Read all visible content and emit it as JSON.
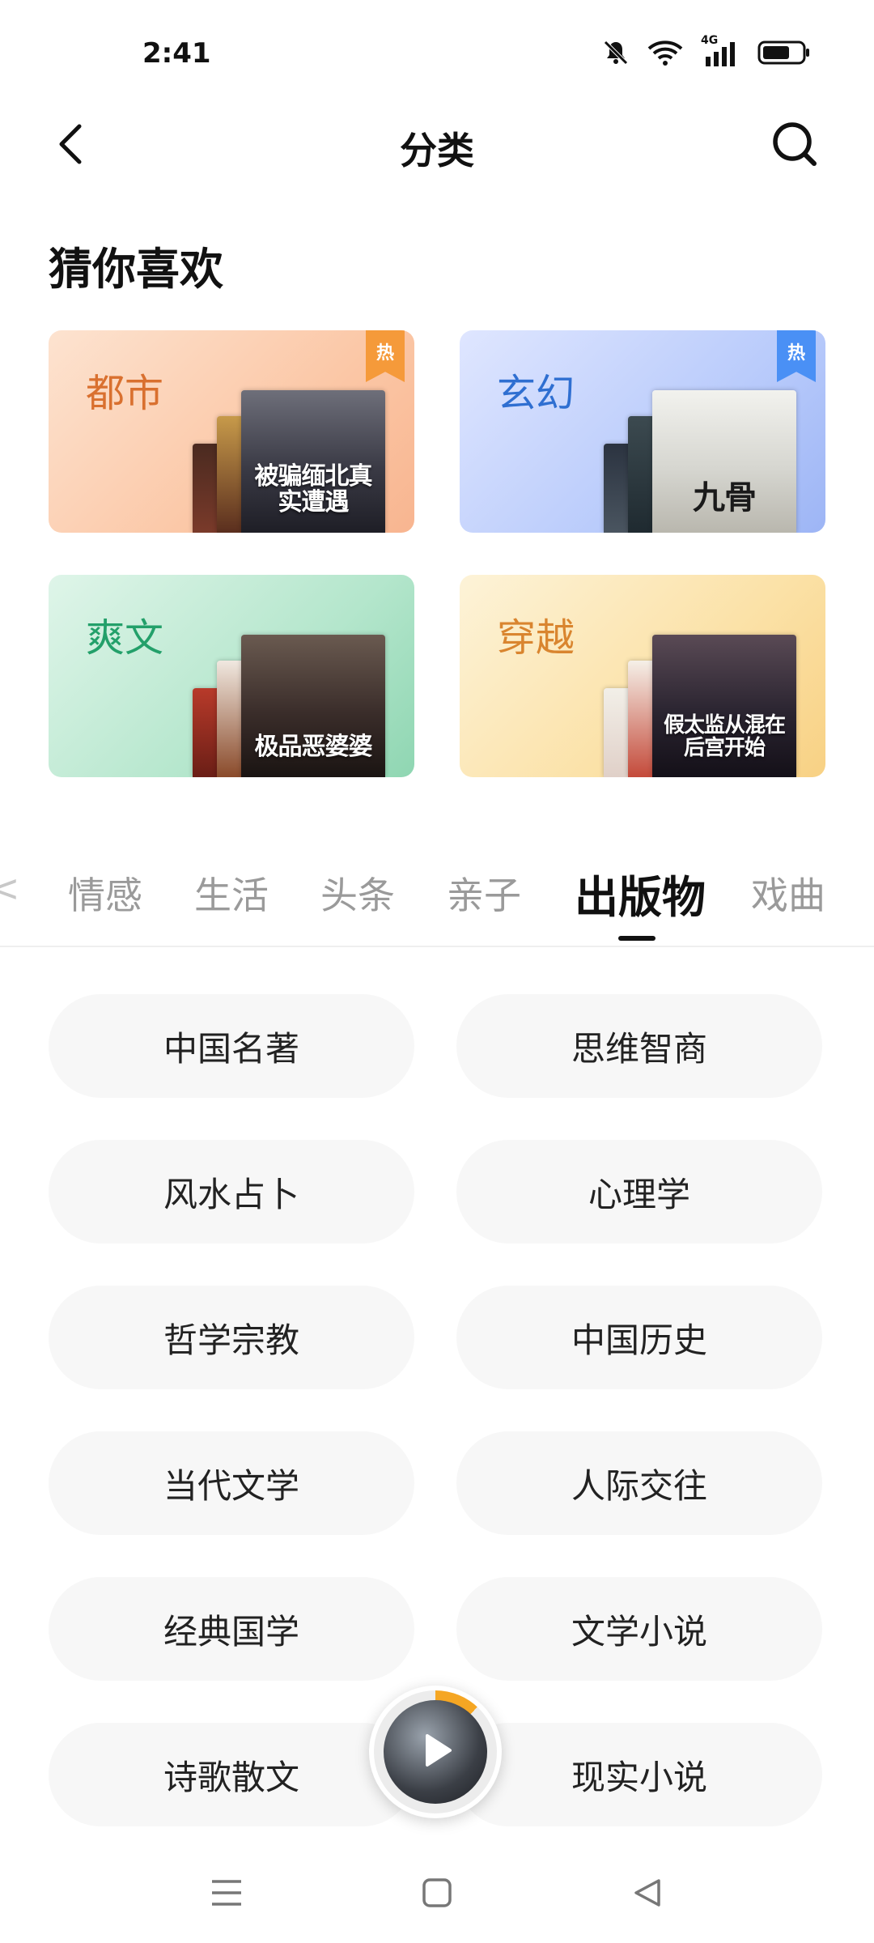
{
  "status_bar": {
    "time": "2:41",
    "network_label": "4G",
    "icons": [
      "bell-muted-icon",
      "wifi-icon",
      "cellular-signal-icon",
      "battery-icon"
    ],
    "battery_level": 0.7
  },
  "header": {
    "title": "分类",
    "back_icon": "chevron-left-icon",
    "search_icon": "search-icon"
  },
  "recommend": {
    "title": "猜你喜欢",
    "cards": [
      {
        "label": "都市",
        "hot": true,
        "hot_label": "热",
        "label_color": "#d9702f",
        "cover_text": "被骗缅北真实遭遇",
        "book_colors": [
          "#2b2b35",
          "#7a3a2a",
          "#c79a4a"
        ]
      },
      {
        "label": "玄幻",
        "hot": true,
        "hot_label": "热",
        "label_color": "#2f6fd1",
        "cover_text": "九骨",
        "book_colors": [
          "#e9e9e6",
          "#3c4a50",
          "#2b3340"
        ]
      },
      {
        "label": "爽文",
        "hot": false,
        "hot_label": "",
        "label_color": "#23a06a",
        "cover_text": "极品恶婆婆",
        "book_colors": [
          "#3a2d2a",
          "#8a4a2a",
          "#b83a2a"
        ]
      },
      {
        "label": "穿越",
        "hot": false,
        "hot_label": "",
        "label_color": "#d9852f",
        "cover_text": "假太监从混在后宫开始",
        "book_colors": [
          "#2a2430",
          "#f2efe8",
          "#c44a3a"
        ]
      }
    ]
  },
  "tabs": {
    "items": [
      "情感",
      "生活",
      "头条",
      "亲子",
      "出版物",
      "戏曲"
    ],
    "active_index": 4
  },
  "categories": [
    "中国名著",
    "思维智商",
    "风水占卜",
    "心理学",
    "哲学宗教",
    "中国历史",
    "当代文学",
    "人际交往",
    "经典国学",
    "文学小说",
    "诗歌散文",
    "现实小说"
  ],
  "player": {
    "play_icon": "play-icon",
    "progress": 0.12,
    "accent_color": "#f5a623"
  },
  "navbar": {
    "icons": [
      "menu-icon",
      "home-square-icon",
      "back-triangle-icon"
    ]
  },
  "colors": {
    "hot_tag_orange": "#f59a3a",
    "hot_tag_blue": "#4a90f5",
    "pill_bg": "#f7f7f7",
    "tab_inactive": "#9a9a9a"
  }
}
